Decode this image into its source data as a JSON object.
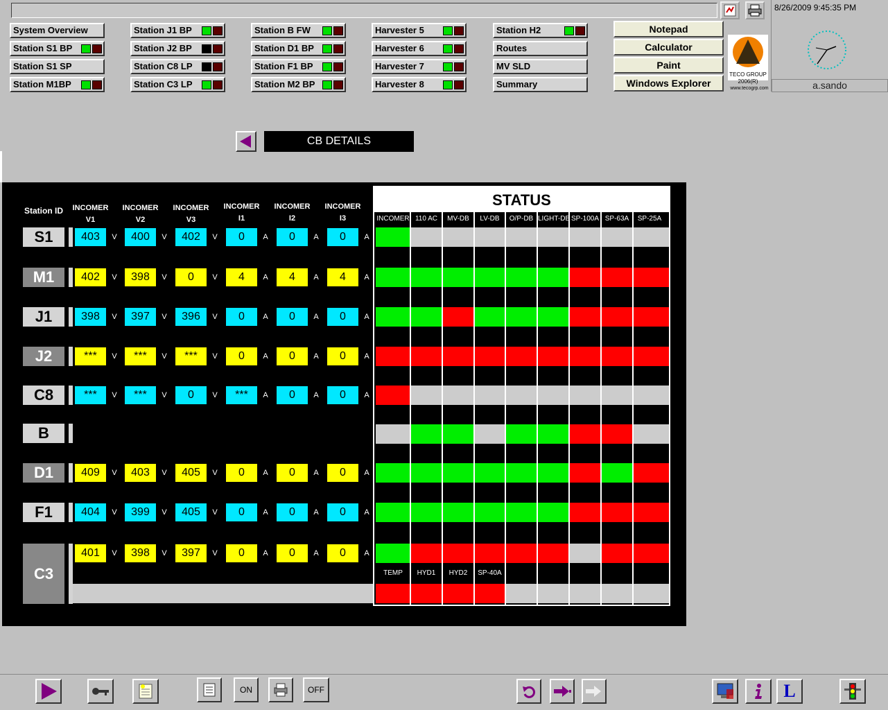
{
  "header": {
    "datetime": "8/26/2009 9:45:35 PM",
    "user": "a.sando",
    "logo_text": "TECO GROUP",
    "logo_year": "2006(R)",
    "logo_url": "www.tecogrp.com"
  },
  "nav": {
    "col1": [
      {
        "label": "System Overview",
        "ind": null
      },
      {
        "label": "Station S1 BP",
        "ind": [
          "g",
          "r"
        ]
      },
      {
        "label": "Station S1 SP",
        "ind": null
      },
      {
        "label": "Station M1BP",
        "ind": [
          "g",
          "r"
        ]
      }
    ],
    "col2": [
      {
        "label": "Station J1 BP",
        "ind": [
          "g",
          "r"
        ]
      },
      {
        "label": "Station J2 BP",
        "ind": [
          "k",
          "r"
        ]
      },
      {
        "label": "Station C8 LP",
        "ind": [
          "k",
          "r"
        ]
      },
      {
        "label": "Station C3 LP",
        "ind": [
          "g",
          "r"
        ]
      }
    ],
    "col3": [
      {
        "label": "Station B FW",
        "ind": [
          "g",
          "r"
        ]
      },
      {
        "label": "Station D1 BP",
        "ind": [
          "g",
          "r"
        ]
      },
      {
        "label": "Station F1 BP",
        "ind": [
          "g",
          "r"
        ]
      },
      {
        "label": "Station M2 BP",
        "ind": [
          "g",
          "r"
        ]
      }
    ],
    "col4": [
      {
        "label": "Harvester 5",
        "ind": [
          "g",
          "r"
        ]
      },
      {
        "label": "Harvester 6",
        "ind": [
          "g",
          "r"
        ]
      },
      {
        "label": "Harvester 7",
        "ind": [
          "g",
          "r"
        ]
      },
      {
        "label": "Harvester 8",
        "ind": [
          "g",
          "r"
        ]
      }
    ],
    "col5": [
      {
        "label": "Station H2",
        "ind": [
          "g",
          "r"
        ]
      },
      {
        "label": "Routes",
        "ind": null
      },
      {
        "label": "MV SLD",
        "ind": null
      },
      {
        "label": "Summary",
        "ind": null
      }
    ],
    "apps": [
      "Notepad",
      "Calculator",
      "Paint",
      "Windows Explorer"
    ]
  },
  "cb": {
    "title": "CB DETAILS",
    "station_id_label": "Station ID",
    "headers": [
      [
        "INCOMER",
        "V1"
      ],
      [
        "INCOMER",
        "V2"
      ],
      [
        "INCOMER",
        "V3"
      ],
      [
        "INCOMER",
        "I1"
      ],
      [
        "INCOMER",
        "I2"
      ],
      [
        "INCOMER",
        "I3"
      ]
    ],
    "units": [
      "V",
      "V",
      "V",
      "A",
      "A",
      "A"
    ],
    "stations": [
      {
        "id": "S1",
        "dark": false,
        "vals": [
          "403",
          "400",
          "402",
          "0",
          "0",
          "0"
        ],
        "colors": [
          "c",
          "c",
          "c",
          "c",
          "c",
          "c"
        ]
      },
      {
        "id": "M1",
        "dark": true,
        "vals": [
          "402",
          "398",
          "0",
          "4",
          "4",
          "4"
        ],
        "colors": [
          "y",
          "y",
          "y",
          "y",
          "y",
          "y"
        ]
      },
      {
        "id": "J1",
        "dark": false,
        "vals": [
          "398",
          "397",
          "396",
          "0",
          "0",
          "0"
        ],
        "colors": [
          "c",
          "c",
          "c",
          "c",
          "c",
          "c"
        ]
      },
      {
        "id": "J2",
        "dark": true,
        "vals": [
          "***",
          "***",
          "***",
          "0",
          "0",
          "0"
        ],
        "colors": [
          "y",
          "y",
          "y",
          "y",
          "y",
          "y"
        ]
      },
      {
        "id": "C8",
        "dark": false,
        "vals": [
          "***",
          "***",
          "0",
          "***",
          "0",
          "0"
        ],
        "colors": [
          "c",
          "c",
          "c",
          "c",
          "c",
          "c"
        ]
      },
      {
        "id": "B",
        "dark": false,
        "vals": null,
        "colors": null
      },
      {
        "id": "D1",
        "dark": true,
        "vals": [
          "409",
          "403",
          "405",
          "0",
          "0",
          "0"
        ],
        "colors": [
          "y",
          "y",
          "y",
          "y",
          "y",
          "y"
        ]
      },
      {
        "id": "F1",
        "dark": false,
        "vals": [
          "404",
          "399",
          "405",
          "0",
          "0",
          "0"
        ],
        "colors": [
          "c",
          "c",
          "c",
          "c",
          "c",
          "c"
        ]
      },
      {
        "id": "C3",
        "dark": true,
        "vals": [
          "401",
          "398",
          "397",
          "0",
          "0",
          "0"
        ],
        "colors": [
          "y",
          "y",
          "y",
          "y",
          "y",
          "y"
        ]
      }
    ]
  },
  "status": {
    "title": "STATUS",
    "columns": [
      "INCOMER",
      "110 AC",
      "MV-DB",
      "LV-DB",
      "O/P-DB",
      "LIGHT-DB",
      "SP-100A",
      "SP-63A",
      "SP-25A"
    ],
    "rows": [
      [
        "g",
        "l",
        "l",
        "l",
        "l",
        "l",
        "l",
        "l",
        "l"
      ],
      [
        "g",
        "g",
        "g",
        "g",
        "g",
        "g",
        "r",
        "r",
        "r"
      ],
      [
        "g",
        "g",
        "r",
        "g",
        "g",
        "g",
        "r",
        "r",
        "r"
      ],
      [
        "r",
        "r",
        "r",
        "r",
        "r",
        "r",
        "r",
        "r",
        "r"
      ],
      [
        "r",
        "l",
        "l",
        "l",
        "l",
        "l",
        "l",
        "l",
        "l"
      ],
      [
        "l",
        "g",
        "g",
        "l",
        "g",
        "g",
        "r",
        "r",
        "l"
      ],
      [
        "g",
        "g",
        "g",
        "g",
        "g",
        "g",
        "r",
        "g",
        "r"
      ],
      [
        "g",
        "g",
        "g",
        "g",
        "g",
        "g",
        "r",
        "r",
        "r"
      ],
      [
        "g",
        "r",
        "r",
        "r",
        "r",
        "r",
        "l",
        "r",
        "r"
      ]
    ],
    "extra_columns": [
      "TEMP",
      "HYD1",
      "HYD2",
      "SP-40A"
    ],
    "extra_row": [
      "r",
      "r",
      "r",
      "r",
      "l",
      "l",
      "l",
      "l",
      "l"
    ]
  },
  "toolbar": {
    "on_label": "ON",
    "off_label": "OFF"
  }
}
